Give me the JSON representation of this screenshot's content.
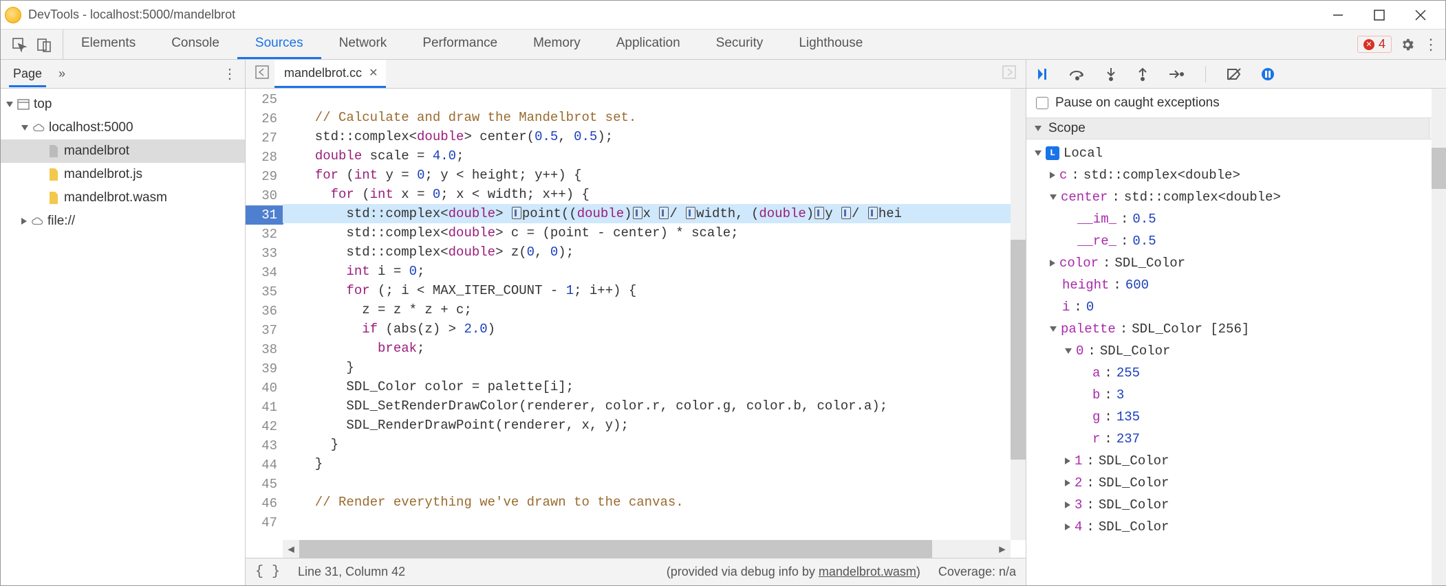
{
  "window": {
    "title": "DevTools - localhost:5000/mandelbrot"
  },
  "tabs": {
    "items": [
      "Elements",
      "Console",
      "Sources",
      "Network",
      "Performance",
      "Memory",
      "Application",
      "Security",
      "Lighthouse"
    ],
    "active": "Sources",
    "error_count": "4"
  },
  "nav": {
    "page_label": "Page",
    "tree": {
      "top": "top",
      "host": "localhost:5000",
      "files": [
        "mandelbrot",
        "mandelbrot.js",
        "mandelbrot.wasm"
      ],
      "other": "file://"
    }
  },
  "editor": {
    "filename": "mandelbrot.cc",
    "first_line_no": 25,
    "breakpoint_line": 31,
    "lines": [
      "",
      "  // Calculate and draw the Mandelbrot set.",
      "  std::complex<double> center(0.5, 0.5);",
      "  double scale = 4.0;",
      "  for (int y = 0; y < height; y++) {",
      "    for (int x = 0; x < width; x++) {",
      "      std::complex<double> ☐point((double)☐x ☐/ ☐width, (double)☐y ☐/ ☐hei",
      "      std::complex<double> c = (point - center) * scale;",
      "      std::complex<double> z(0, 0);",
      "      int i = 0;",
      "      for (; i < MAX_ITER_COUNT - 1; i++) {",
      "        z = z * z + c;",
      "        if (abs(z) > 2.0)",
      "          break;",
      "      }",
      "      SDL_Color color = palette[i];",
      "      SDL_SetRenderDrawColor(renderer, color.r, color.g, color.b, color.a);",
      "      SDL_RenderDrawPoint(renderer, x, y);",
      "    }",
      "  }",
      "",
      "  // Render everything we've drawn to the canvas.",
      ""
    ]
  },
  "status": {
    "cursor": "Line 31, Column 42",
    "debug_info_pre": "(provided via debug info by ",
    "debug_info_link": "mandelbrot.wasm",
    "debug_info_post": ")",
    "coverage": "Coverage: n/a"
  },
  "debug": {
    "pause_caught_label": "Pause on caught exceptions",
    "scope_label": "Scope",
    "local_label": "Local",
    "vars": {
      "c": {
        "name": "c",
        "type": "std::complex<double>"
      },
      "center": {
        "name": "center",
        "type": "std::complex<double>",
        "im_key": "__im_",
        "im_val": "0.5",
        "re_key": "__re_",
        "re_val": "0.5"
      },
      "color": {
        "name": "color",
        "type": "SDL_Color"
      },
      "height": {
        "name": "height",
        "val": "600"
      },
      "i": {
        "name": "i",
        "val": "0"
      },
      "palette": {
        "name": "palette",
        "type": "SDL_Color [256]",
        "item0": {
          "idx": "0",
          "type": "SDL_Color",
          "a": "255",
          "b": "3",
          "g": "135",
          "r": "237"
        },
        "item1": {
          "idx": "1",
          "type": "SDL_Color"
        },
        "item2": {
          "idx": "2",
          "type": "SDL_Color"
        },
        "item3": {
          "idx": "3",
          "type": "SDL_Color"
        },
        "item4": {
          "idx": "4",
          "type": "SDL_Color"
        }
      }
    }
  }
}
